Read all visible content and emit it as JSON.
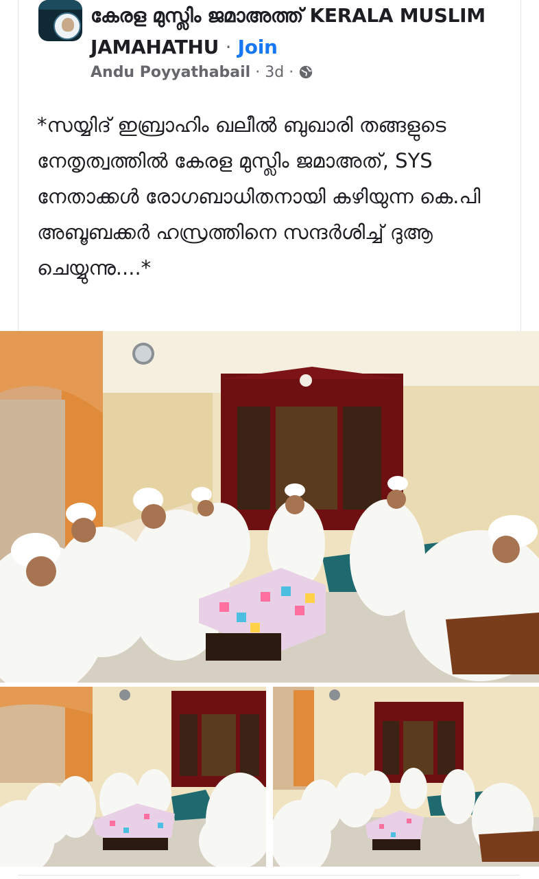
{
  "group": {
    "title": "കേരള മുസ്ലിം ജമാഅത്ത് KERALA MUSLIM JAMAHATHU",
    "separator": "·",
    "join_label": "Join"
  },
  "post": {
    "author": "Andu Poyyathabail",
    "sep1": "·",
    "time": "3d",
    "sep2": "·",
    "privacy_icon": "globe-icon",
    "text": "*സയ്യിദ് ഇബ്രാഹിം ഖലീൽ ബുഖാരി തങ്ങളുടെ നേതൃത്വത്തിൽ കേരള മുസ്ലിം ജമാഅത്, SYS നേതാക്കൾ രോഗബാധിതനായി കഴിയുന്ന കെ.പി അബൂബക്കർ ഹസ്രത്തിനെ സന്ദർശിച്ച് ദുആ ചെയ്യുന്നു....*"
  },
  "colors": {
    "join": "#1877f2",
    "meta": "#65676b",
    "text": "#1c1e21"
  }
}
